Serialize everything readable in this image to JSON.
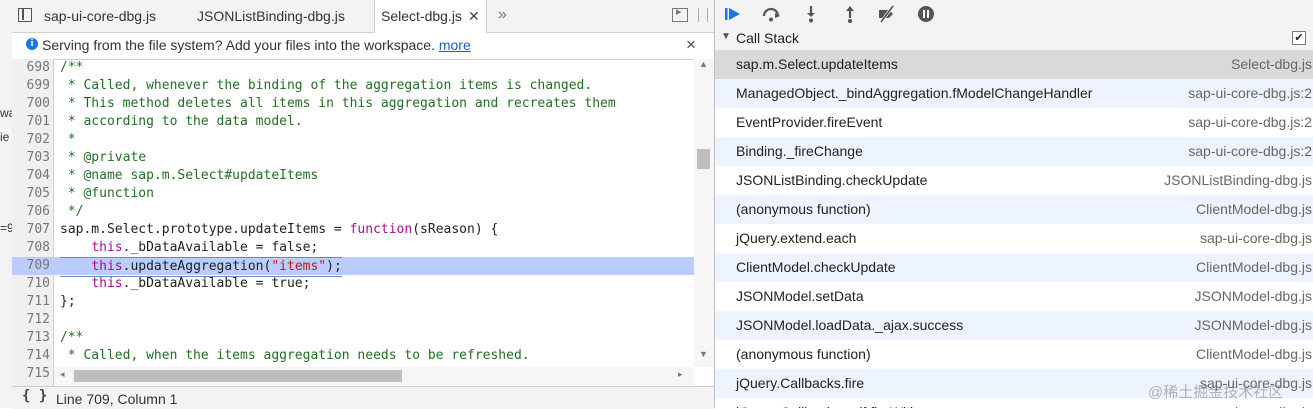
{
  "left_strip": {
    "fragments": [
      "wa",
      "ie",
      "=9"
    ]
  },
  "tabs": [
    {
      "label": "sap-ui-core-dbg.js",
      "active": false
    },
    {
      "label": "JSONListBinding-dbg.js",
      "active": false
    },
    {
      "label": "Select-dbg.js",
      "active": true,
      "close": "✕"
    }
  ],
  "tab_overflow": "»",
  "infobar": {
    "message": "Serving from the file system? Add your files into the workspace.",
    "link": "more",
    "close": "×"
  },
  "code_lines": [
    {
      "num": "698",
      "text": "/**",
      "kind": "comment"
    },
    {
      "num": "699",
      "text": " * Called, whenever the binding of the aggregation items is changed.",
      "kind": "comment"
    },
    {
      "num": "700",
      "text": " * This method deletes all items in this aggregation and recreates them",
      "kind": "comment"
    },
    {
      "num": "701",
      "text": " * according to the data model.",
      "kind": "comment"
    },
    {
      "num": "702",
      "text": " *",
      "kind": "comment"
    },
    {
      "num": "703",
      "text": " * @private",
      "kind": "comment"
    },
    {
      "num": "704",
      "text": " * @name sap.m.Select#updateItems",
      "kind": "comment"
    },
    {
      "num": "705",
      "text": " * @function",
      "kind": "comment"
    },
    {
      "num": "706",
      "text": " */",
      "kind": "comment"
    },
    {
      "num": "707",
      "a": "sap.m.Select.prototype.updateItems = ",
      "kw": "function",
      "b": "(sReason) {",
      "kind": "fn"
    },
    {
      "num": "708",
      "pre": "    ",
      "kw": "this",
      "b": "._bDataAvailable = false;",
      "kind": "this"
    },
    {
      "num": "709",
      "pre": "    ",
      "kw": "this",
      "b": ".updateAggregation(",
      "str": "\"items\"",
      "c": ");",
      "kind": "this-str",
      "highlight": true
    },
    {
      "num": "710",
      "pre": "    ",
      "kw": "this",
      "b": "._bDataAvailable = true;",
      "kind": "this"
    },
    {
      "num": "711",
      "text": "};",
      "kind": "plain"
    },
    {
      "num": "712",
      "text": "",
      "kind": "plain"
    },
    {
      "num": "713",
      "text": "/**",
      "kind": "comment"
    },
    {
      "num": "714",
      "text": " * Called, when the items aggregation needs to be refreshed.",
      "kind": "comment"
    },
    {
      "num": "715",
      "text": "",
      "kind": "plain"
    }
  ],
  "status": {
    "braces": "{ }",
    "position": "Line 709, Column 1"
  },
  "toolbar_icons": [
    "resume-icon",
    "step-over-icon",
    "step-into-icon",
    "step-out-icon",
    "deactivate-breakpoints-icon",
    "pause-on-exceptions-icon"
  ],
  "call_stack": {
    "title": "Call Stack",
    "check": "✔",
    "frames": [
      {
        "fn": "sap.m.Select.updateItems",
        "src": "Select-dbg.js"
      },
      {
        "fn": "ManagedObject._bindAggregation.fModelChangeHandler",
        "src": "sap-ui-core-dbg.js:2"
      },
      {
        "fn": "EventProvider.fireEvent",
        "src": "sap-ui-core-dbg.js:2"
      },
      {
        "fn": "Binding._fireChange",
        "src": "sap-ui-core-dbg.js:2"
      },
      {
        "fn": "JSONListBinding.checkUpdate",
        "src": "JSONListBinding-dbg.js"
      },
      {
        "fn": "(anonymous function)",
        "src": "ClientModel-dbg.js"
      },
      {
        "fn": "jQuery.extend.each",
        "src": "sap-ui-core-dbg.js"
      },
      {
        "fn": "ClientModel.checkUpdate",
        "src": "ClientModel-dbg.js"
      },
      {
        "fn": "JSONModel.setData",
        "src": "JSONModel-dbg.js"
      },
      {
        "fn": "JSONModel.loadData._ajax.success",
        "src": "JSONModel-dbg.js"
      },
      {
        "fn": "(anonymous function)",
        "src": "ClientModel-dbg.js"
      },
      {
        "fn": "jQuery.Callbacks.fire",
        "src": "sap-ui-core-dbg.js"
      },
      {
        "fn": "jQuery.Callbacks.self.fireWith",
        "src": "sap-ui-core-dbg.js"
      }
    ]
  },
  "watermark": "@稀土掘金技术社区"
}
